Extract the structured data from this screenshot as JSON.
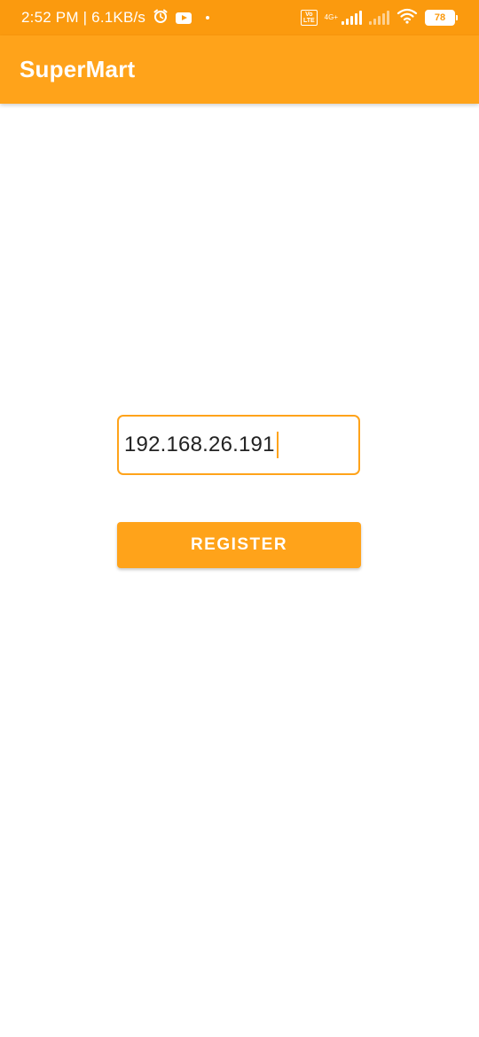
{
  "status_bar": {
    "time_speed": "2:52 PM | 6.1KB/s",
    "icons": [
      "alarm-icon",
      "youtube-icon",
      "dot-icon",
      "volte-icon",
      "signal-icon",
      "wifi-icon",
      "battery-icon"
    ],
    "volte_label": "Vo\nLTE",
    "network_label": "4G+",
    "battery_level": "78"
  },
  "app_bar": {
    "title": "SuperMart",
    "color": "#FFA31A"
  },
  "form": {
    "ip_value": "192.168.26.191",
    "register_label": "REGISTER"
  },
  "colors": {
    "status_bar": "#FB9A0E",
    "accent": "#FFA31A",
    "background": "#FFFFFF"
  }
}
